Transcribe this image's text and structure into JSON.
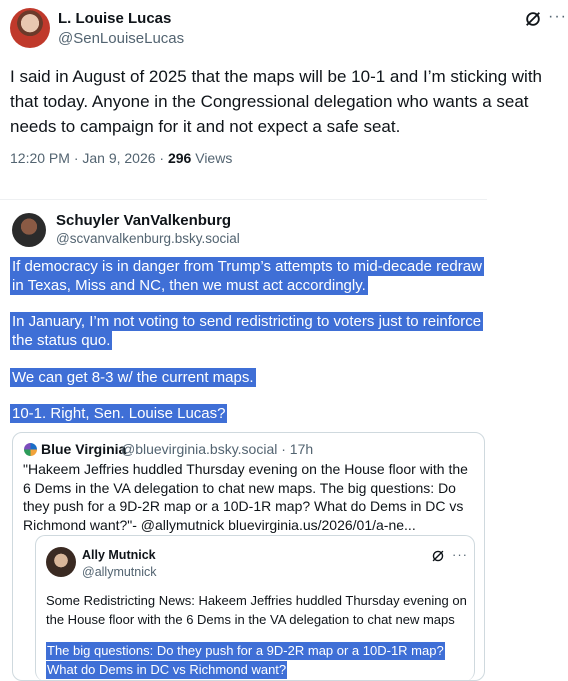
{
  "main_tweet": {
    "name": "L. Louise Lucas",
    "handle": "@SenLouiseLucas",
    "text": "I said in August of 2025 that the maps will be 10-1 and I’m sticking with that today.  Anyone in the Congressional delegation who wants a seat needs to campaign for it and not expect a safe seat.",
    "time": "12:20 PM · Jan 9, 2026 · ",
    "views_count": "296",
    "views_label": " Views"
  },
  "embedded_post": {
    "name": "Schuyler VanValkenburg",
    "handle": "@scvanvalkenburg.bsky.social",
    "lines": [
      "If democracy is in danger from Trump’s attempts to mid-decade redraw",
      "in Texas, Miss and NC, then we must act accordingly.",
      "In January, I’m not voting to send redistricting to voters just to reinforce",
      "the status quo.",
      "We can get 8-3 w/ the current maps.",
      "10-1. Right, Sen. Louise Lucas?"
    ]
  },
  "quote_post": {
    "name": "Blue Virginia",
    "handle": "@bluevirginia.bsky.social · 17h",
    "text": "\"Hakeem Jeffries huddled Thursday evening on the House floor with the 6 Dems in the VA delegation to chat new maps. The big questions: Do they push for a 9D-2R map or a 10D-1R map? What do Dems in DC vs Richmond want?\"- @allymutnick  bluevirginia.us/2026/01/a-ne..."
  },
  "nested_quote": {
    "name": "Ally Mutnick",
    "handle": "@allymutnick",
    "text": "Some Redistricting News: Hakeem Jeffries huddled Thursday evening on the House floor with the 6 Dems in the VA delegation to chat new maps",
    "highlight_lines": [
      "The big questions: Do they push for a 9D-2R map or a 10D-1R map?",
      "What do Dems in DC vs Richmond want?"
    ]
  },
  "icons": {
    "grok": "grok-icon",
    "more": "more-icon"
  },
  "colors": {
    "highlight": "#3f6fd6",
    "secondary_text": "#536471"
  }
}
